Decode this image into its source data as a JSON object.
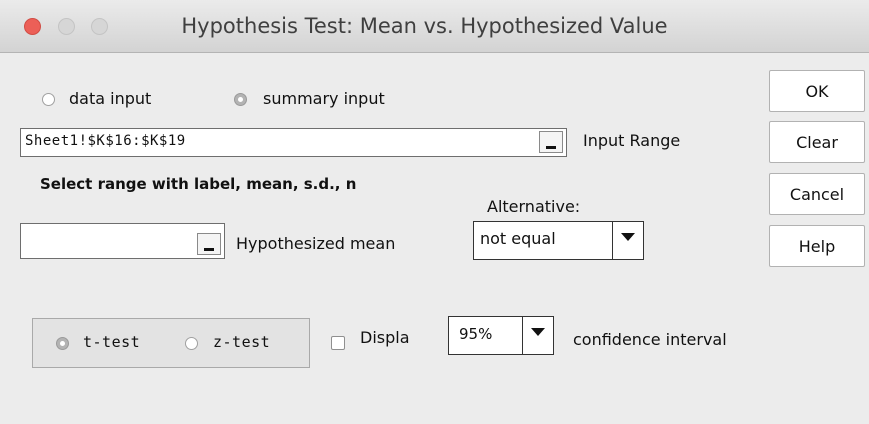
{
  "window": {
    "title": "Hypothesis Test: Mean vs. Hypothesized Value"
  },
  "input_mode": {
    "data_label": "data input",
    "summary_label": "summary input",
    "selected": "summary input"
  },
  "input_range": {
    "value": "Sheet1!$K$16:$K$19",
    "label": "Input Range",
    "hint": "Select range with label, mean, s.d., n"
  },
  "hypothesized": {
    "value": "",
    "label": "Hypothesized mean"
  },
  "alternative": {
    "label": "Alternative:",
    "selected": "not equal"
  },
  "test_type": {
    "t_label": "t-test",
    "z_label": "z-test",
    "selected": "t-test"
  },
  "display": {
    "label": "Displa",
    "checked": false,
    "confidence": "95%",
    "suffix": "confidence interval"
  },
  "buttons": {
    "ok": "OK",
    "clear": "Clear",
    "cancel": "Cancel",
    "help": "Help"
  }
}
